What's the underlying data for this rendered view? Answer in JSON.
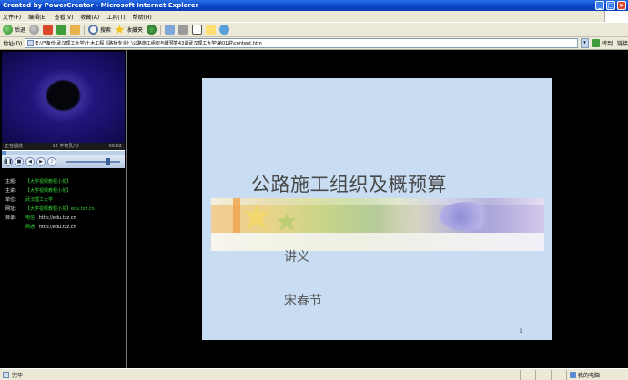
{
  "window": {
    "title": "Created by PowerCreator - Microsoft Internet Explorer"
  },
  "menu": {
    "items": [
      "文件(F)",
      "编辑(E)",
      "查看(V)",
      "收藏(A)",
      "工具(T)",
      "帮助(H)"
    ]
  },
  "toolbar": {
    "back_label": "后退",
    "search_label": "搜索",
    "favorites_label": "收藏夹"
  },
  "address": {
    "label": "地址(D)",
    "value": "E:\\已备份\\武汉理工大学\\土木工程《路桥专业》\\公路施工组织与概预算43讲武汉理工大学\\第01讲\\content.htm",
    "go_label": "转到",
    "links_label": "链接"
  },
  "player": {
    "status": "正在播放",
    "track": "12  牛初乳/秒",
    "time": "00:02",
    "progress_percent": 4,
    "controls": [
      "pause",
      "stop",
      "prev",
      "next",
      "mute"
    ]
  },
  "info": {
    "rows": [
      {
        "key": "主题：",
        "value": "【大学视频教程小花】"
      },
      {
        "key": "主讲：",
        "value": "【大学视频教程小花】"
      },
      {
        "key": "单位：",
        "value": "武汉理工大学"
      },
      {
        "key": "网址：",
        "value": "【大学视频教程小花】edu.tzz.cn"
      },
      {
        "key": "目录：",
        "value": "电信",
        "link": "http://edu.tzz.cn"
      }
    ],
    "sub_row": {
      "value": "网通",
      "link": "http://edu.tzz.cn"
    }
  },
  "slide": {
    "title": "公路施工组织及概预算",
    "subtitle": "讲义",
    "author": "宋春节",
    "page": "1"
  },
  "status": {
    "text": "完毕",
    "zone": "我的电脑"
  },
  "colors": {
    "titlebar": "#0a46c8",
    "chrome": "#ece9d8",
    "slide_bg": "#c8dcf2",
    "info_value": "#37d437"
  }
}
